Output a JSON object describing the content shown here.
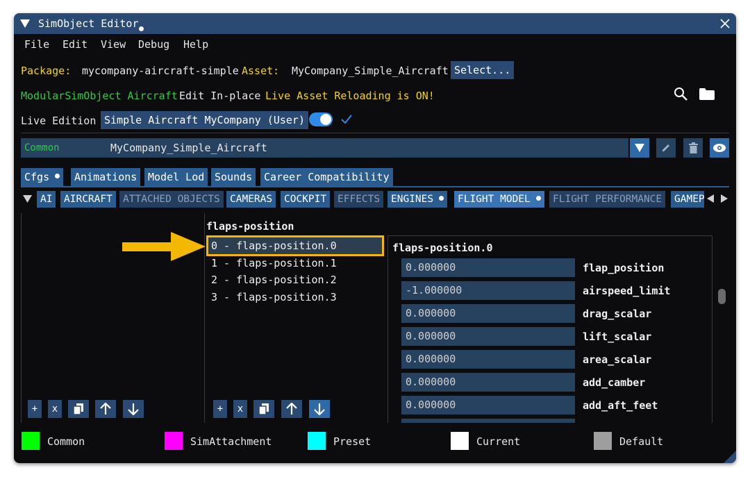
{
  "title_bar": {
    "title": "SimObject Editor",
    "close_icon": "close-icon",
    "collapse_icon": "triangle-down-icon"
  },
  "menu": [
    "File",
    "Edit",
    "View",
    "Debug",
    "Help"
  ],
  "package_row": {
    "package_label": "Package:",
    "package_value": "mycompany-aircraft-simple",
    "asset_label": "Asset:",
    "asset_value": "MyCompany_Simple_Aircraft",
    "select_button": "Select..."
  },
  "status_row": {
    "type_text": "ModularSimObject Aircraft",
    "edit_mode": "Edit In-place",
    "reload_status": "Live Asset Reloading is ON!"
  },
  "live_row": {
    "label": "Live Edition",
    "selection": "Simple Aircraft MyCompany (User)",
    "toggle_on": true
  },
  "object_row": {
    "category": "Common",
    "name": "MyCompany_Simple_Aircraft"
  },
  "top_tabs": [
    "Cfgs",
    "Animations",
    "Model Lod",
    "Sounds",
    "Career Compatibility"
  ],
  "section_tabs": [
    "AI",
    "AIRCRAFT",
    "ATTACHED OBJECTS",
    "CAMERAS",
    "COCKPIT",
    "EFFECTS",
    "ENGINES",
    "FLIGHT MODEL",
    "FLIGHT PERFORMANCE",
    "GAMEP"
  ],
  "section": {
    "header": "flaps-position",
    "items": [
      "0 - flaps-position.0",
      "1 - flaps-position.1",
      "2 - flaps-position.2",
      "3 - flaps-position.3"
    ],
    "selected_header": "flaps-position.0",
    "fields": [
      {
        "value": "0.000000",
        "label": "flap_position"
      },
      {
        "value": "-1.000000",
        "label": "airspeed_limit"
      },
      {
        "value": "0.000000",
        "label": "drag_scalar"
      },
      {
        "value": "0.000000",
        "label": "lift_scalar"
      },
      {
        "value": "0.000000",
        "label": "area_scalar"
      },
      {
        "value": "0.000000",
        "label": "add_camber"
      },
      {
        "value": "0.000000",
        "label": "add_aft_feet"
      }
    ]
  },
  "toolbar": {
    "add": "+",
    "remove": "x"
  },
  "legend": [
    {
      "label": "Common",
      "color": "#00ff00"
    },
    {
      "label": "SimAttachment",
      "color": "#ff00ff"
    },
    {
      "label": "Preset",
      "color": "#00ffff"
    },
    {
      "label": "Current",
      "color": "#ffffff"
    },
    {
      "label": "Default",
      "color": "#9e9e9e"
    }
  ],
  "colors": {
    "accent": "#2a4a73",
    "highlight": "#f5b800",
    "yellow_text": "#f5d600",
    "green_text": "#26d13a"
  }
}
